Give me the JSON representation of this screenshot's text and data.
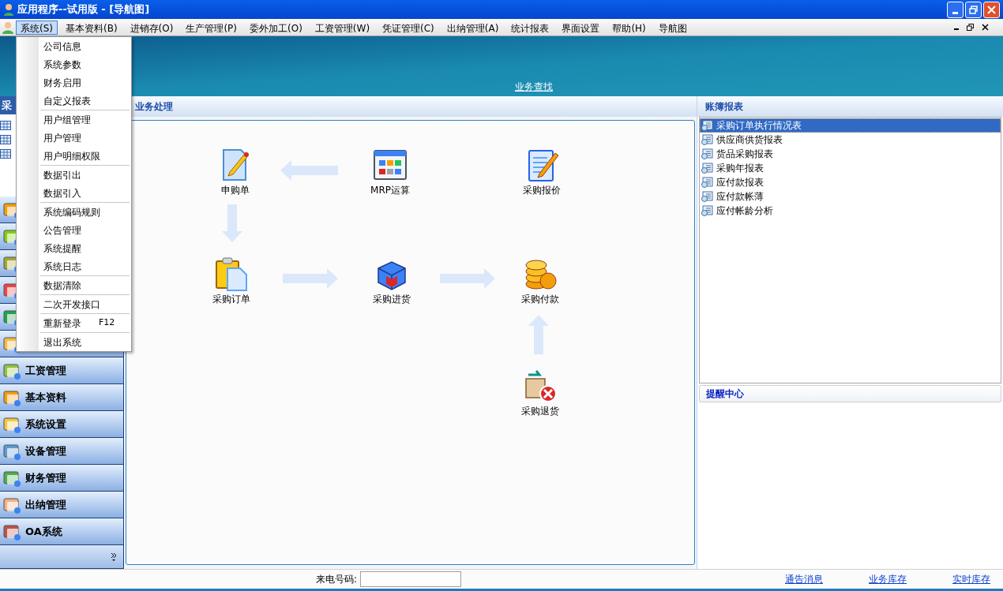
{
  "window": {
    "title": "应用程序--试用版 - [导航图]"
  },
  "menu_bar": [
    {
      "label": "系统(S)",
      "selected": true
    },
    {
      "label": "基本资料(B)",
      "selected": false
    },
    {
      "label": "进销存(O)",
      "selected": false
    },
    {
      "label": "生产管理(P)",
      "selected": false
    },
    {
      "label": "委外加工(O)",
      "selected": false
    },
    {
      "label": "工资管理(W)",
      "selected": false
    },
    {
      "label": "凭证管理(C)",
      "selected": false
    },
    {
      "label": "出纳管理(A)",
      "selected": false
    },
    {
      "label": "统计报表",
      "selected": false
    },
    {
      "label": "界面设置",
      "selected": false
    },
    {
      "label": "帮助(H)",
      "selected": false
    },
    {
      "label": "导航图",
      "selected": false
    }
  ],
  "open_menu": {
    "groups": [
      [
        {
          "label": "公司信息"
        },
        {
          "label": "系统参数"
        },
        {
          "label": "财务启用"
        },
        {
          "label": "自定义报表"
        }
      ],
      [
        {
          "label": "用户组管理"
        },
        {
          "label": "用户管理"
        },
        {
          "label": "用户明细权限"
        }
      ],
      [
        {
          "label": "数据引出"
        },
        {
          "label": "数据引入"
        }
      ],
      [
        {
          "label": "系统编码规则"
        },
        {
          "label": "公告管理"
        },
        {
          "label": "系统提醒"
        },
        {
          "label": "系统日志"
        }
      ],
      [
        {
          "label": "数据清除"
        }
      ],
      [
        {
          "label": "二次开发接口"
        }
      ],
      [
        {
          "label": "重新登录",
          "shortcut": "F12"
        }
      ],
      [
        {
          "label": "退出系统"
        }
      ]
    ]
  },
  "banner": {
    "link": "业务查找"
  },
  "sidebar": {
    "header": "采",
    "modules": [
      {
        "kind": "covered"
      },
      {
        "kind": "covered"
      },
      {
        "kind": "covered"
      },
      {
        "kind": "covered"
      },
      {
        "kind": "covered"
      },
      {
        "kind": "covered"
      },
      {
        "kind": "labeled",
        "label": "工资管理"
      },
      {
        "kind": "labeled",
        "label": "基本资料"
      },
      {
        "kind": "labeled",
        "label": "系统设置"
      },
      {
        "kind": "labeled",
        "label": "设备管理"
      },
      {
        "kind": "labeled",
        "label": "财务管理"
      },
      {
        "kind": "labeled",
        "label": "出纳管理"
      },
      {
        "kind": "labeled",
        "label": "OA系统"
      }
    ]
  },
  "workflow": {
    "title": "业务处理",
    "nodes": [
      {
        "kind": "pencil-doc",
        "label": "申购单"
      },
      {
        "kind": "grid-window",
        "label": "MRP运算"
      },
      {
        "kind": "notepad",
        "label": "采购报价"
      },
      {
        "kind": "clipboard",
        "label": "采购订单"
      },
      {
        "kind": "box",
        "label": "采购进货"
      },
      {
        "kind": "coins",
        "label": "采购付款"
      },
      {
        "kind": "return",
        "label": "采购退货"
      }
    ]
  },
  "reports": {
    "title": "账簿报表",
    "items": [
      {
        "label": "采购订单执行情况表",
        "selected": true
      },
      {
        "label": "供应商供货报表",
        "selected": false
      },
      {
        "label": "货品采购报表",
        "selected": false
      },
      {
        "label": "采购年报表",
        "selected": false
      },
      {
        "label": "应付款报表",
        "selected": false
      },
      {
        "label": "应付款帐薄",
        "selected": false
      },
      {
        "label": "应付帐龄分析",
        "selected": false
      }
    ]
  },
  "reminders": {
    "title": "提醒中心"
  },
  "status_bar": {
    "phone_label": "来电号码:",
    "links": [
      "通告消息",
      "业务库存",
      "实时库存"
    ]
  }
}
